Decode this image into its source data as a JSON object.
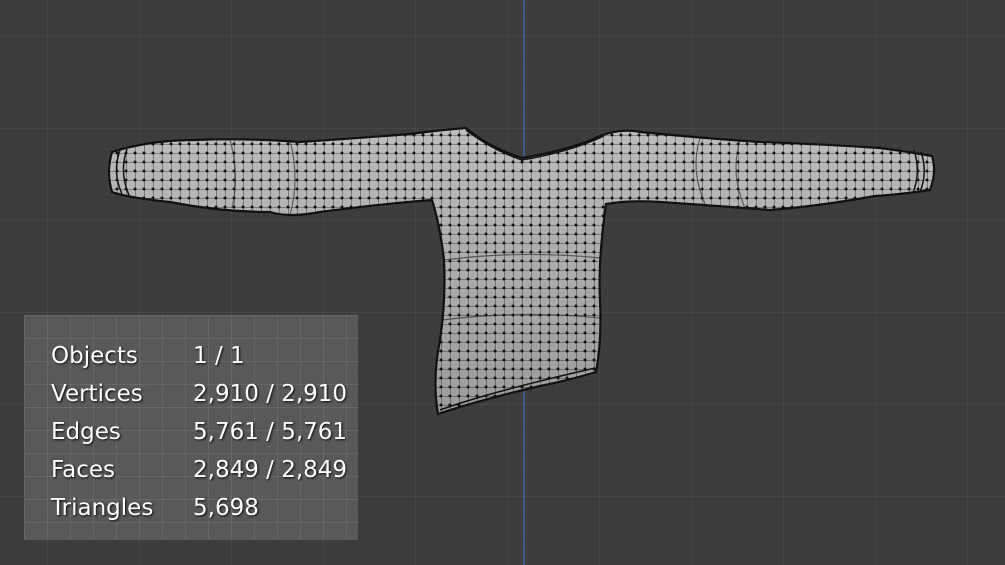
{
  "viewport": {
    "background_color": "#3d3d3d",
    "axis_color": "#3f5a88",
    "mesh_fill": "#a9a9a9",
    "wire_color": "#1a1a1a"
  },
  "statistics": {
    "rows": [
      {
        "label": "Objects",
        "value": "1 / 1"
      },
      {
        "label": "Vertices",
        "value": "2,910 / 2,910"
      },
      {
        "label": "Edges",
        "value": "5,761 / 5,761"
      },
      {
        "label": "Faces",
        "value": "2,849 / 2,849"
      },
      {
        "label": "Triangles",
        "value": "5,698"
      }
    ]
  }
}
